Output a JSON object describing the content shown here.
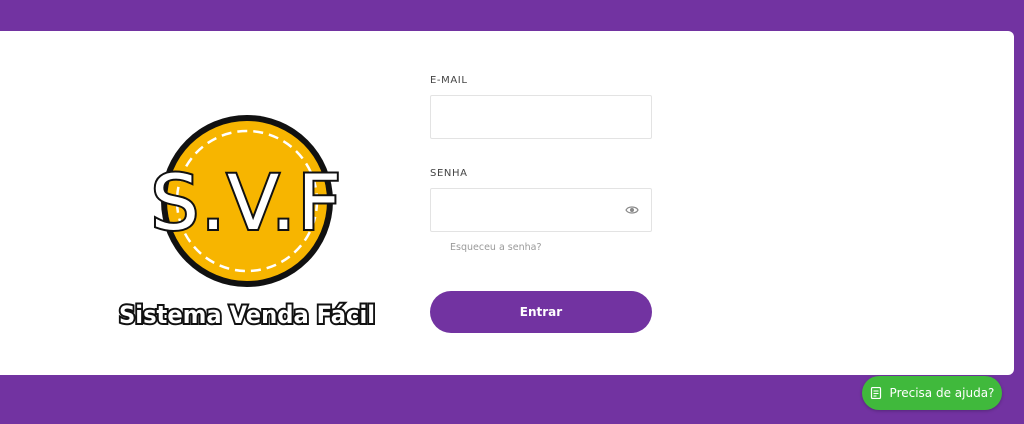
{
  "logo": {
    "main_text": "S.V.F",
    "subtitle": "Sistema Venda Fácil"
  },
  "form": {
    "email_label": "E-MAIL",
    "email_value": "",
    "password_label": "SENHA",
    "password_value": "",
    "forgot_link": "Esqueceu a senha?",
    "submit_label": "Entrar",
    "password_toggle_icon": "eye-icon"
  },
  "help": {
    "label": "Precisa de ajuda?",
    "icon": "chat-icon"
  },
  "colors": {
    "background": "#7233a1",
    "card": "#ffffff",
    "button": "#7233a1",
    "help_button": "#40b93c",
    "logo_coin": "#f7b500"
  }
}
